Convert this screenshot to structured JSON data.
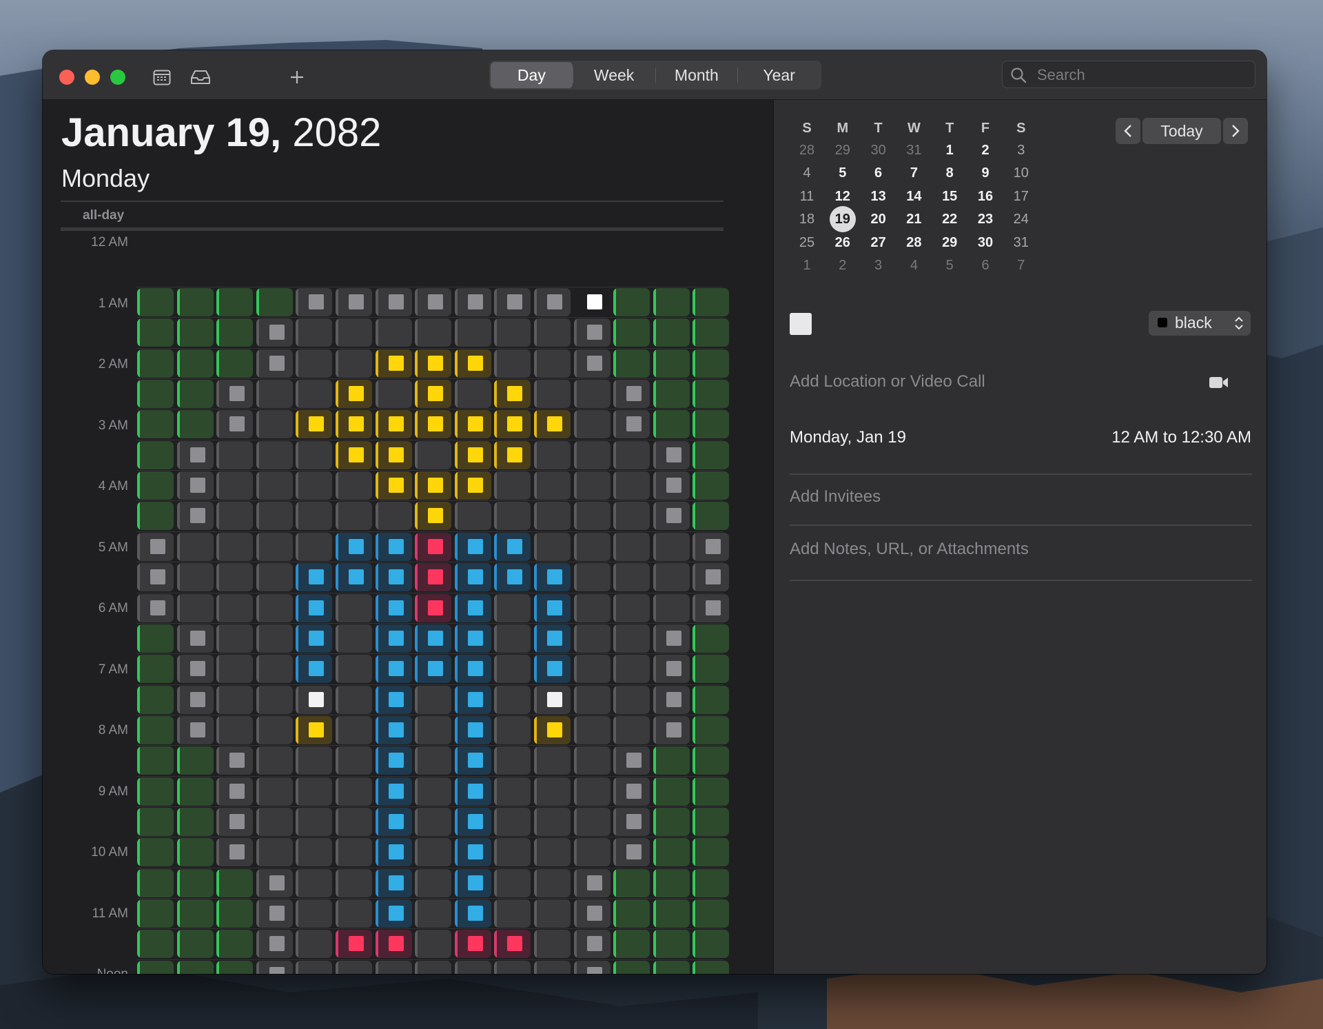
{
  "toolbar": {
    "views": [
      "Day",
      "Week",
      "Month",
      "Year"
    ],
    "active_view": "Day",
    "search_placeholder": "Search"
  },
  "day_header": {
    "date_bold": "January 19,",
    "year": " 2082",
    "weekday": "Monday",
    "allday_label": "all-day"
  },
  "time_labels": [
    "12 AM",
    "1 AM",
    "2 AM",
    "3 AM",
    "4 AM",
    "5 AM",
    "6 AM",
    "7 AM",
    "8 AM",
    "9 AM",
    "10 AM",
    "11 AM",
    "Noon"
  ],
  "mini_calendar": {
    "weekday_headers": [
      "S",
      "M",
      "T",
      "W",
      "T",
      "F",
      "S"
    ],
    "weeks": [
      [
        "28",
        "29",
        "30",
        "31",
        "1",
        "2",
        "3"
      ],
      [
        "4",
        "5",
        "6",
        "7",
        "8",
        "9",
        "10"
      ],
      [
        "11",
        "12",
        "13",
        "14",
        "15",
        "16",
        "17"
      ],
      [
        "18",
        "19",
        "20",
        "21",
        "22",
        "23",
        "24"
      ],
      [
        "25",
        "26",
        "27",
        "28",
        "29",
        "30",
        "31"
      ],
      [
        "1",
        "2",
        "3",
        "4",
        "5",
        "6",
        "7"
      ]
    ],
    "selected_day": "19",
    "today_label": "Today",
    "prev_icon": "chevron-left-icon",
    "next_icon": "chevron-right-icon"
  },
  "event_inspector": {
    "swatch_color": "#e8e8ea",
    "calendar_color_label": "black",
    "location_placeholder": "Add Location or Video Call",
    "video_icon": "video-camera-icon",
    "date_text": "Monday, Jan 19",
    "time_range": "12 AM to 12:30 AM",
    "invitees_placeholder": "Add Invitees",
    "notes_placeholder": "Add Notes, URL, or Attachments"
  },
  "colors": {
    "G": {
      "bg": "#2d4a2d",
      "bar": "#34c759",
      "sq": null
    },
    "D": {
      "bg": "#3a3a3c",
      "bar": "#5c5c5f",
      "sq": null
    },
    "g": {
      "bg": "#3a3a3c",
      "bar": "#5c5c5f",
      "sq": "#8e8e92"
    },
    "W": {
      "bg": "#1f1f21",
      "bar": "#1f1f21",
      "sq": "#ffffff"
    },
    "w": {
      "bg": "#3a3a3c",
      "bar": "#5c5c5f",
      "sq": "#f2f2f2"
    },
    "Y": {
      "bg": "#4b3f1b",
      "bar": "#e2b714",
      "sq": "#ffd60a"
    },
    "B": {
      "bg": "#1f3a4e",
      "bar": "#2a8fd0",
      "sq": "#32ade6"
    },
    "P": {
      "bg": "#4e2233",
      "bar": "#d63a6c",
      "sq": "#ff375f"
    }
  },
  "event_grid": [
    "GGGGgggggggWGGG",
    "GGGgDDDDDDDgGGG",
    "GGGgDDYYYDDgGGG",
    "GGgDDYDYDYDDgGG",
    "GGgDYYYYYYYDgGG",
    "GgDDDYYDYYDDDgG",
    "GgDDDDYYYDDDDgG",
    "GgDDDDDYDDDDDgG",
    "gDDDDBBPBBDDDDg",
    "gDDDBBBPBBBDDDg",
    "gDDDBDBPBDBDDDg",
    "GgDDBDBBBDBDDgG",
    "GgDDBDBBBDBDDgG",
    "GgDDwDBDBDwDDgG",
    "GgDDYDBDBDYDDgG",
    "GGgDDDBDBDDDgGG",
    "GGgDDDBDBDDDgGG",
    "GGgDDDBDBDDDgGG",
    "GGgDDDBDBDDDgGG",
    "GGGgDDBDBDDgGGG",
    "GGGgDDBDBDDgGGG",
    "GGGgDPPDPPDgGGG",
    "GGGgDDDDDDDgGGG",
    "GGGGgggggggGGGG"
  ]
}
